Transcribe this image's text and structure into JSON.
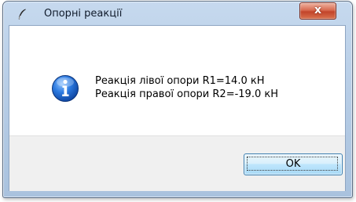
{
  "window": {
    "title": "Опорні реакції",
    "close_label": "x"
  },
  "dialog": {
    "icon": "information-icon",
    "lines": [
      "Реакція лівої опори R1=14.0 кН",
      "Реакція правої опори R2=-19.0 кН"
    ],
    "ok_label": "OK"
  },
  "colors": {
    "title_bar": "#b7cde6",
    "close_button": "#c2442a",
    "ok_button_accent": "#3c7fb1",
    "info_icon": "#1f64c8"
  }
}
